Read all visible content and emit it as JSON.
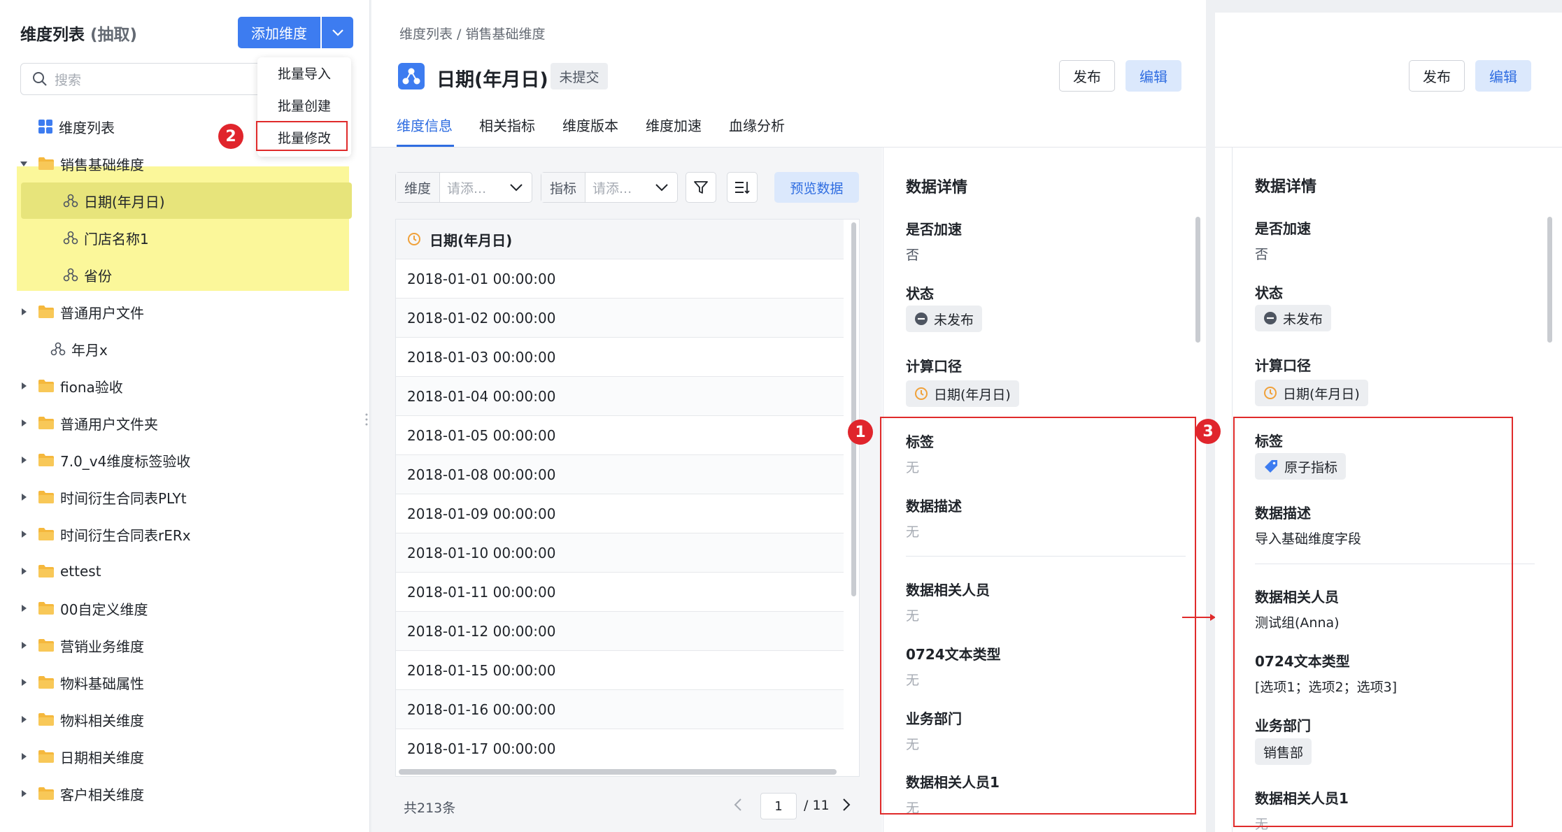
{
  "sidebar": {
    "title": "维度列表",
    "title_sub": "(抽取)",
    "add_button": "添加维度",
    "search_placeholder": "搜索",
    "menu": [
      "批量导入",
      "批量创建",
      "批量修改"
    ],
    "tree": [
      {
        "label": "维度列表",
        "type": "grid",
        "indent": 0,
        "caret": "none"
      },
      {
        "label": "销售基础维度",
        "type": "folder",
        "indent": 0,
        "caret": "down"
      },
      {
        "label": "日期(年月日)",
        "type": "dimension",
        "indent": 2,
        "caret": "none"
      },
      {
        "label": "门店名称1",
        "type": "dimension",
        "indent": 2,
        "caret": "none"
      },
      {
        "label": "省份",
        "type": "dimension",
        "indent": 2,
        "caret": "none"
      },
      {
        "label": "普通用户文件",
        "type": "folder",
        "indent": 0,
        "caret": "right"
      },
      {
        "label": "年月x",
        "type": "dimension",
        "indent": 1,
        "caret": "none"
      },
      {
        "label": "fiona验收",
        "type": "folder",
        "indent": 0,
        "caret": "right"
      },
      {
        "label": "普通用户文件夹",
        "type": "folder",
        "indent": 0,
        "caret": "right"
      },
      {
        "label": "7.0_v4维度标签验收",
        "type": "folder",
        "indent": 0,
        "caret": "right"
      },
      {
        "label": "时间衍生合同表PLYt",
        "type": "folder",
        "indent": 0,
        "caret": "right"
      },
      {
        "label": "时间衍生合同表rERx",
        "type": "folder",
        "indent": 0,
        "caret": "right"
      },
      {
        "label": "ettest",
        "type": "folder",
        "indent": 0,
        "caret": "right"
      },
      {
        "label": "00自定义维度",
        "type": "folder",
        "indent": 0,
        "caret": "right"
      },
      {
        "label": "营销业务维度",
        "type": "folder",
        "indent": 0,
        "caret": "right"
      },
      {
        "label": "物料基础属性",
        "type": "folder",
        "indent": 0,
        "caret": "right"
      },
      {
        "label": "物料相关维度",
        "type": "folder",
        "indent": 0,
        "caret": "right"
      },
      {
        "label": "日期相关维度",
        "type": "folder",
        "indent": 0,
        "caret": "right"
      },
      {
        "label": "客户相关维度",
        "type": "folder",
        "indent": 0,
        "caret": "right"
      }
    ]
  },
  "main": {
    "breadcrumb": "维度列表 / 销售基础维度",
    "title": "日期(年月日)",
    "status_tag": "未提交",
    "publish": "发布",
    "edit": "编辑",
    "tabs": [
      "维度信息",
      "相关指标",
      "维度版本",
      "维度加速",
      "血缘分析"
    ],
    "filter_dim_label": "维度",
    "filter_dim_placeholder": "请添...",
    "filter_metric_label": "指标",
    "filter_metric_placeholder": "请添...",
    "preview_button": "预览数据",
    "table_header": "日期(年月日)",
    "rows": [
      "2018-01-01 00:00:00",
      "2018-01-02 00:00:00",
      "2018-01-03 00:00:00",
      "2018-01-04 00:00:00",
      "2018-01-05 00:00:00",
      "2018-01-08 00:00:00",
      "2018-01-09 00:00:00",
      "2018-01-10 00:00:00",
      "2018-01-11 00:00:00",
      "2018-01-12 00:00:00",
      "2018-01-15 00:00:00",
      "2018-01-16 00:00:00",
      "2018-01-17 00:00:00"
    ],
    "total": "共213条",
    "page": "1",
    "page_total": "/ 11"
  },
  "detail": {
    "title": "数据详情",
    "accel_label": "是否加速",
    "accel_value": "否",
    "status_label": "状态",
    "status_value": "未发布",
    "calc_label": "计算口径",
    "calc_value": "日期(年月日)",
    "tag_label": "标签",
    "tag_value": "无",
    "desc_label": "数据描述",
    "desc_value": "无",
    "people_label": "数据相关人员",
    "people_value": "无",
    "text_type_label": "0724文本类型",
    "text_type_value": "无",
    "dept_label": "业务部门",
    "dept_value": "无",
    "people1_label": "数据相关人员1",
    "people1_value": "无"
  },
  "detail_after": {
    "publish": "发布",
    "edit": "编辑",
    "title": "数据详情",
    "accel_label": "是否加速",
    "accel_value": "否",
    "status_label": "状态",
    "status_value": "未发布",
    "calc_label": "计算口径",
    "calc_value": "日期(年月日)",
    "tag_label": "标签",
    "tag_value": "原子指标",
    "desc_label": "数据描述",
    "desc_value": "导入基础维度字段",
    "people_label": "数据相关人员",
    "people_value": "测试组(Anna)",
    "text_type_label": "0724文本类型",
    "text_type_value": "[选项1；选项2；选项3]",
    "dept_label": "业务部门",
    "dept_value": "销售部",
    "people1_label": "数据相关人员1",
    "people1_value": "无"
  },
  "annotations": {
    "badge1": "1",
    "badge2": "2",
    "badge3": "3"
  },
  "colors": {
    "primary": "#3d7cf0",
    "highlight": "#fbf79a",
    "annotation_red": "#e02b2b",
    "folder": "#f5b83d"
  }
}
